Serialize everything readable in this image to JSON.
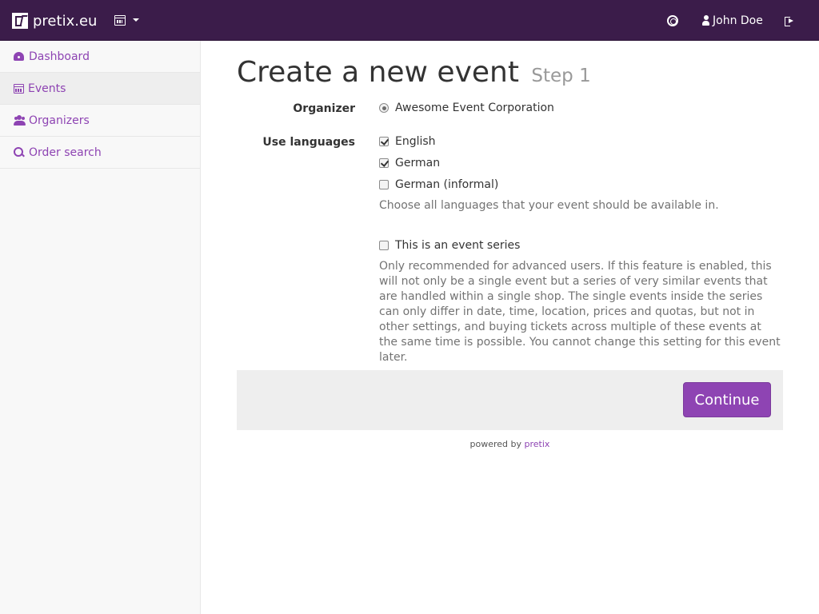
{
  "navbar": {
    "brand": "pretix.eu",
    "user_name": "John Doe"
  },
  "sidebar": {
    "items": [
      {
        "label": "Dashboard",
        "icon": "dashboard-icon"
      },
      {
        "label": "Events",
        "icon": "calendar-icon",
        "active": true
      },
      {
        "label": "Organizers",
        "icon": "users-icon"
      },
      {
        "label": "Order search",
        "icon": "search-icon"
      }
    ]
  },
  "main": {
    "title": "Create a new event",
    "step": "Step 1",
    "organizer": {
      "label": "Organizer",
      "option": "Awesome Event Corporation",
      "checked": true
    },
    "languages": {
      "label": "Use languages",
      "options": [
        {
          "label": "English",
          "checked": true
        },
        {
          "label": "German",
          "checked": true
        },
        {
          "label": "German (informal)",
          "checked": false
        }
      ],
      "help": "Choose all languages that your event should be available in."
    },
    "series": {
      "label": "This is an event series",
      "checked": false,
      "help": "Only recommended for advanced users. If this feature is enabled, this will not only be a single event but a series of very similar events that are handled within a single shop. The single events inside the series can only differ in date, time, location, prices and quotas, but not in other settings, and buying tickets across multiple of these events at the same time is possible. You cannot change this setting for this event later."
    },
    "continue_label": "Continue"
  },
  "footer": {
    "powered_by": "powered by",
    "link": "pretix"
  },
  "colors": {
    "navbar": "#3b1c4a",
    "accent": "#8e44b3",
    "sidebar_bg": "#f8f8f8"
  }
}
